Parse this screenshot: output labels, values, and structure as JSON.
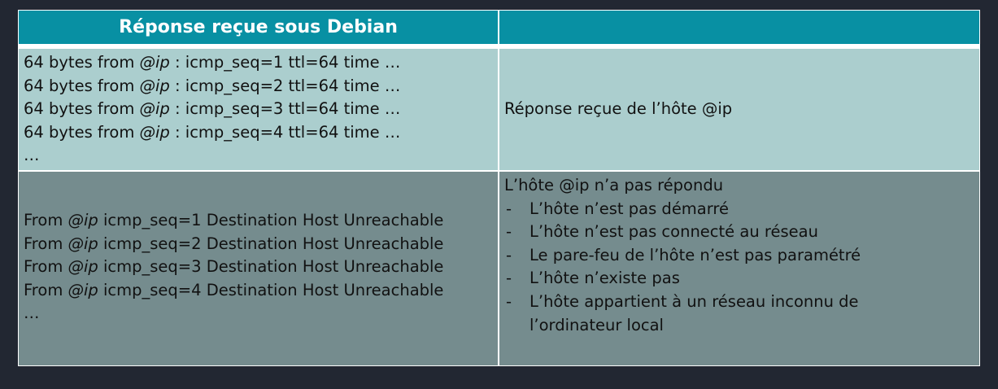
{
  "header": {
    "left_title": "Réponse reçue sous Debian",
    "right_title": ""
  },
  "row1": {
    "lines": [
      {
        "prefix": "64 bytes from ",
        "ip": "@ip",
        "suffix": " : icmp_seq=1 ttl=64 time …"
      },
      {
        "prefix": "64 bytes from ",
        "ip": "@ip",
        "suffix": " : icmp_seq=2 ttl=64 time …"
      },
      {
        "prefix": "64 bytes from ",
        "ip": "@ip",
        "suffix": " : icmp_seq=3 ttl=64 time …"
      },
      {
        "prefix": "64 bytes from ",
        "ip": "@ip",
        "suffix": " : icmp_seq=4 ttl=64 time …"
      }
    ],
    "ellipsis": "…",
    "meaning": "Réponse reçue de l’hôte @ip"
  },
  "row2": {
    "lines": [
      {
        "prefix": "From ",
        "ip": "@ip",
        "suffix": " icmp_seq=1 Destination Host Unreachable"
      },
      {
        "prefix": "From ",
        "ip": "@ip",
        "suffix": " icmp_seq=2 Destination Host Unreachable"
      },
      {
        "prefix": "From ",
        "ip": "@ip",
        "suffix": " icmp_seq=3 Destination Host Unreachable"
      },
      {
        "prefix": "From ",
        "ip": "@ip",
        "suffix": " icmp_seq=4 Destination Host Unreachable"
      }
    ],
    "ellipsis": "…",
    "meaning_title": "L’hôte @ip n’a pas répondu",
    "bullet_marker": "-",
    "reasons": [
      "L’hôte n’est pas démarré",
      "L’hôte n’est pas connecté au réseau",
      "Le pare-feu de l’hôte n’est pas paramétré",
      "L’hôte n’existe pas",
      "L’hôte appartient à un réseau inconnu de l’ordinateur local"
    ]
  }
}
